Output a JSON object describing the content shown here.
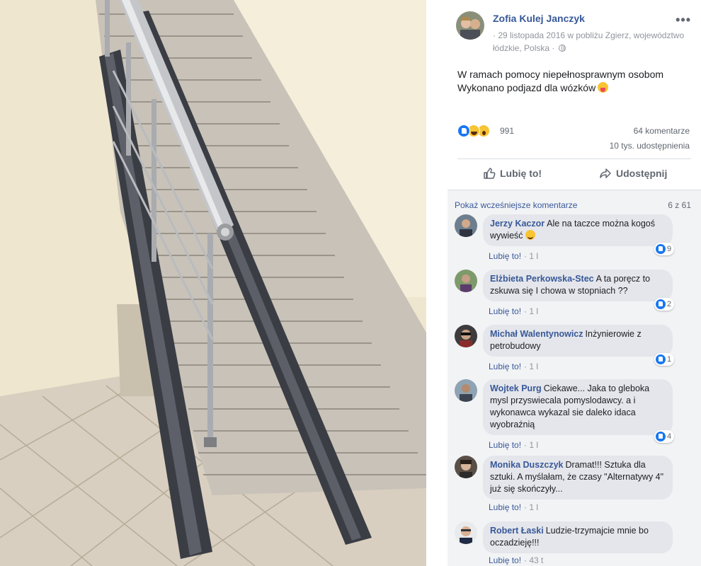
{
  "post": {
    "author": "Zofia Kulej Janczyk",
    "date": "· 29 listopada 2016 w pobliżu Zgierz, województwo łódzkie, Polska ·",
    "text_line1": "W ramach pomocy niepełnosprawnym osobom",
    "text_line2": "Wykonano podjazd dla wózków",
    "more_label": "•••",
    "reaction_count": "991",
    "comments_count": "64 komentarze",
    "shares_count": "10 tys. udostępnienia",
    "like_label": "Lubię to!",
    "share_label": "Udostępnij",
    "reactions": [
      "like-icon",
      "haha-icon",
      "wow-icon"
    ]
  },
  "comments_panel": {
    "show_more": "Pokaż wcześniejsze komentarze",
    "position": "6 z 61",
    "items": [
      {
        "name": "Jerzy Kaczor",
        "text": "Ale na taczce można kogoś wywieść",
        "likes": "9",
        "like_label": "Lubię to!",
        "time": "· 1 l"
      },
      {
        "name": "Elżbieta Perkowska-Stec",
        "text": "A ta poręcz to zskuwa się I chowa w stopniach ??",
        "likes": "2",
        "like_label": "Lubię to!",
        "time": "· 1 l"
      },
      {
        "name": "Michał Walentynowicz",
        "text": "Inżynierowie z petrobudowy",
        "likes": "1",
        "like_label": "Lubię to!",
        "time": "· 1 l"
      },
      {
        "name": "Wojtek Purg",
        "text": "Ciekawe... Jaka to gleboka mysl przyswiecala pomyslodawcy. a i wykonawca wykazal sie daleko idaca wyobraźnią",
        "likes": "4",
        "like_label": "Lubię to!",
        "time": "· 1 l"
      },
      {
        "name": "Monika Duszczyk",
        "text": "Dramat!!! Sztuka dla sztuki. A myślałam, że czasy \"Alternatywy 4\" już się skończyły...",
        "likes": "",
        "like_label": "Lubię to!",
        "time": "· 1 l"
      },
      {
        "name": "Robert Łaski",
        "text": "Ludzie-trzymajcie mnie bo oczadzieję!!!",
        "likes": "",
        "like_label": "Lubię to!",
        "time": "· 43 t"
      }
    ]
  },
  "colors": {
    "link": "#365899",
    "muted": "#90949c",
    "bubble": "#e4e6eb",
    "like_blue": "#1877f2"
  }
}
